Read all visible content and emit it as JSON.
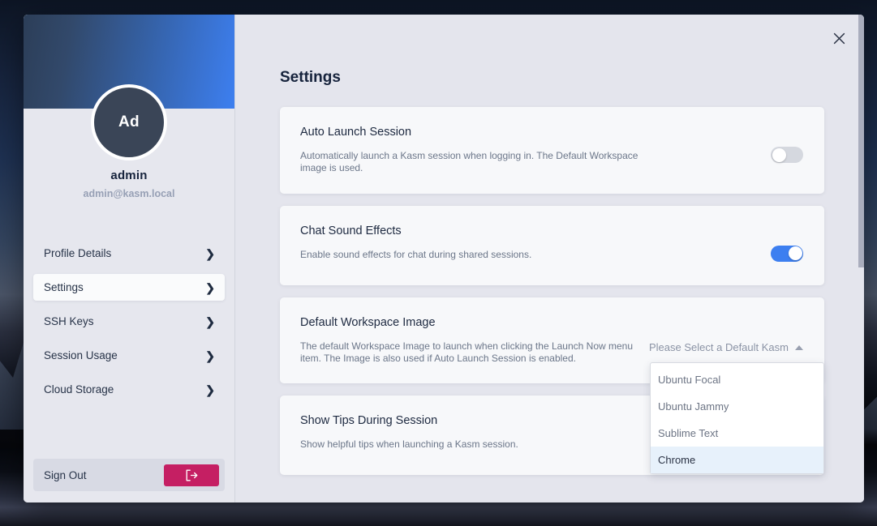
{
  "modal": {
    "close_icon": "close-icon"
  },
  "sidebar": {
    "avatar_initials": "Ad",
    "username": "admin",
    "email": "admin@kasm.local",
    "items": [
      {
        "label": "Profile Details",
        "active": false
      },
      {
        "label": "Settings",
        "active": true
      },
      {
        "label": "SSH Keys",
        "active": false
      },
      {
        "label": "Session Usage",
        "active": false
      },
      {
        "label": "Cloud Storage",
        "active": false
      }
    ],
    "chevron_icon": "chevron-right-icon",
    "sign_out": {
      "label": "Sign Out",
      "button_icon": "sign-out-icon",
      "button_color": "#c51f63"
    }
  },
  "main": {
    "page_title": "Settings",
    "cards": [
      {
        "title": "Auto Launch Session",
        "description": "Automatically launch a Kasm session when logging in. The Default Workspace image is used.",
        "control": "toggle",
        "toggle_on": false
      },
      {
        "title": "Chat Sound Effects",
        "description": "Enable sound effects for chat during shared sessions.",
        "control": "toggle",
        "toggle_on": true
      },
      {
        "title": "Default Workspace Image",
        "description": "The default Workspace Image to launch when clicking the Launch Now menu item. The Image is also used if Auto Launch Session is enabled.",
        "control": "select",
        "select": {
          "placeholder": "Please Select a Default Kasm",
          "value": "",
          "open": true,
          "caret_icon": "caret-up-icon",
          "options": [
            {
              "label": "Ubuntu Focal",
              "highlighted": false
            },
            {
              "label": "Ubuntu Jammy",
              "highlighted": false
            },
            {
              "label": "Sublime Text",
              "highlighted": false
            },
            {
              "label": "Chrome",
              "highlighted": true
            }
          ]
        }
      },
      {
        "title": "Show Tips During Session",
        "description": "Show helpful tips when launching a Kasm session.",
        "control": "none"
      }
    ]
  },
  "theme": {
    "accent_blue": "#3d7ff0",
    "panel_bg": "#e4e5ed",
    "card_bg": "#f7f8fa",
    "title_color": "#16233c",
    "muted_text": "#6b7689",
    "danger": "#c51f63",
    "highlight_bg": "#e7f1fb"
  }
}
